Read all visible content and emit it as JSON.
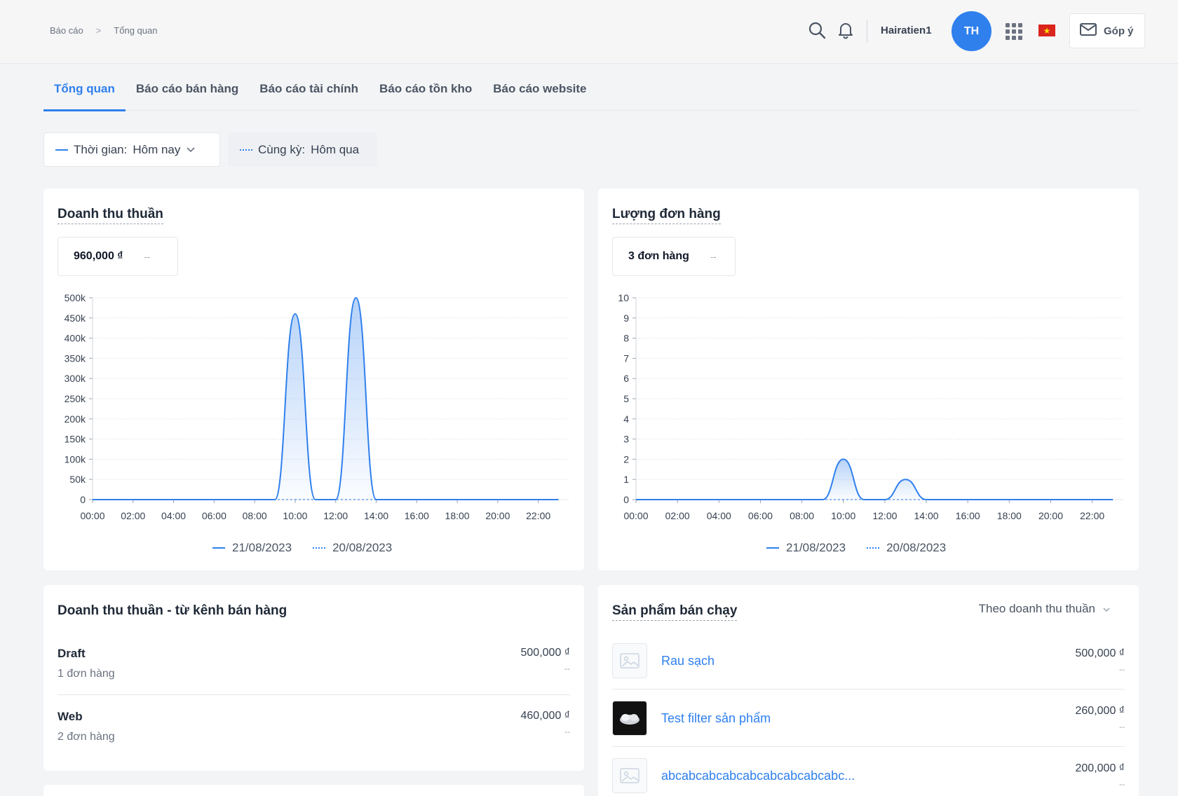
{
  "breadcrumb": [
    "Báo cáo",
    "Tổng quan"
  ],
  "breadcrumb_sep": ">",
  "header": {
    "username": "Hairatien1",
    "avatar_initials": "TH",
    "feedback_label": "Góp ý",
    "icons": [
      "search-icon",
      "bell-icon",
      "apps-grid-icon",
      "vn-flag-icon",
      "mail-icon"
    ]
  },
  "tabs": [
    {
      "label": "Tổng quan",
      "active": true
    },
    {
      "label": "Báo cáo bán hàng",
      "active": false
    },
    {
      "label": "Báo cáo tài chính",
      "active": false
    },
    {
      "label": "Báo cáo tồn kho",
      "active": false
    },
    {
      "label": "Báo cáo website",
      "active": false
    }
  ],
  "filters": {
    "time_label": "Thời gian:",
    "time_value": "Hôm nay",
    "compare_label": "Cùng kỳ:",
    "compare_value": "Hôm qua"
  },
  "revenue_card": {
    "title": "Doanh thu thuần",
    "kpi_value": "960,000 ₫",
    "kpi_compare": "--"
  },
  "orders_card": {
    "title": "Lượng đơn hàng",
    "kpi_value": "3 đơn hàng",
    "kpi_compare": "--"
  },
  "channel_card": {
    "title": "Doanh thu thuần - từ kênh bán hàng",
    "rows": [
      {
        "name": "Draft",
        "sub": "1 đơn hàng",
        "amount": "500,000 ₫",
        "compare": "--"
      },
      {
        "name": "Web",
        "sub": "2 đơn hàng",
        "amount": "460,000 ₫",
        "compare": "--"
      }
    ]
  },
  "top_products_card": {
    "title": "Sản phẩm bán chạy",
    "sort_label": "Theo doanh thu thuần",
    "products": [
      {
        "name": "Rau sạch",
        "amount": "500,000 ₫",
        "compare": "--",
        "thumb": "image-placeholder-icon"
      },
      {
        "name": "Test filter sản phẩm",
        "amount": "260,000 ₫",
        "compare": "--",
        "thumb": "product-photo"
      },
      {
        "name": "abcabcabcabcabcabcabcabcabc...",
        "amount": "200,000 ₫",
        "compare": "--",
        "thumb": "image-placeholder-icon"
      }
    ]
  },
  "colors": {
    "accent": "#2f80ed",
    "grid": "#e5e7eb",
    "text_muted": "#6b7280"
  },
  "chart_data": [
    {
      "type": "area",
      "title": "Doanh thu thuần",
      "x": [
        "00:00",
        "01:00",
        "02:00",
        "03:00",
        "04:00",
        "05:00",
        "06:00",
        "07:00",
        "08:00",
        "09:00",
        "10:00",
        "11:00",
        "12:00",
        "13:00",
        "14:00",
        "15:00",
        "16:00",
        "17:00",
        "18:00",
        "19:00",
        "20:00",
        "21:00",
        "22:00",
        "23:00"
      ],
      "xticks": [
        "00:00",
        "02:00",
        "04:00",
        "06:00",
        "08:00",
        "10:00",
        "12:00",
        "14:00",
        "16:00",
        "18:00",
        "20:00",
        "22:00"
      ],
      "yticks": [
        "0",
        "50k",
        "100k",
        "150k",
        "200k",
        "250k",
        "300k",
        "350k",
        "400k",
        "450k",
        "500k"
      ],
      "ylim": [
        0,
        500000
      ],
      "series": [
        {
          "name": "21/08/2023",
          "style": "solid",
          "values": [
            0,
            0,
            0,
            0,
            0,
            0,
            0,
            0,
            0,
            0,
            460000,
            0,
            0,
            500000,
            0,
            0,
            0,
            0,
            0,
            0,
            0,
            0,
            0,
            0
          ]
        },
        {
          "name": "20/08/2023",
          "style": "dashed",
          "values": [
            0,
            0,
            0,
            0,
            0,
            0,
            0,
            0,
            0,
            0,
            0,
            0,
            0,
            0,
            0,
            0,
            0,
            0,
            0,
            0,
            0,
            0,
            0,
            0
          ]
        }
      ],
      "grid": true,
      "legend_position": "bottom"
    },
    {
      "type": "area",
      "title": "Lượng đơn hàng",
      "x": [
        "00:00",
        "01:00",
        "02:00",
        "03:00",
        "04:00",
        "05:00",
        "06:00",
        "07:00",
        "08:00",
        "09:00",
        "10:00",
        "11:00",
        "12:00",
        "13:00",
        "14:00",
        "15:00",
        "16:00",
        "17:00",
        "18:00",
        "19:00",
        "20:00",
        "21:00",
        "22:00",
        "23:00"
      ],
      "xticks": [
        "00:00",
        "02:00",
        "04:00",
        "06:00",
        "08:00",
        "10:00",
        "12:00",
        "14:00",
        "16:00",
        "18:00",
        "20:00",
        "22:00"
      ],
      "yticks": [
        "0",
        "1",
        "2",
        "3",
        "4",
        "5",
        "6",
        "7",
        "8",
        "9",
        "10"
      ],
      "ylim": [
        0,
        10
      ],
      "series": [
        {
          "name": "21/08/2023",
          "style": "solid",
          "values": [
            0,
            0,
            0,
            0,
            0,
            0,
            0,
            0,
            0,
            0,
            2,
            0,
            0,
            1,
            0,
            0,
            0,
            0,
            0,
            0,
            0,
            0,
            0,
            0
          ]
        },
        {
          "name": "20/08/2023",
          "style": "dashed",
          "values": [
            0,
            0,
            0,
            0,
            0,
            0,
            0,
            0,
            0,
            0,
            0,
            0,
            0,
            0,
            0,
            0,
            0,
            0,
            0,
            0,
            0,
            0,
            0,
            0
          ]
        }
      ],
      "grid": true,
      "legend_position": "bottom"
    }
  ]
}
